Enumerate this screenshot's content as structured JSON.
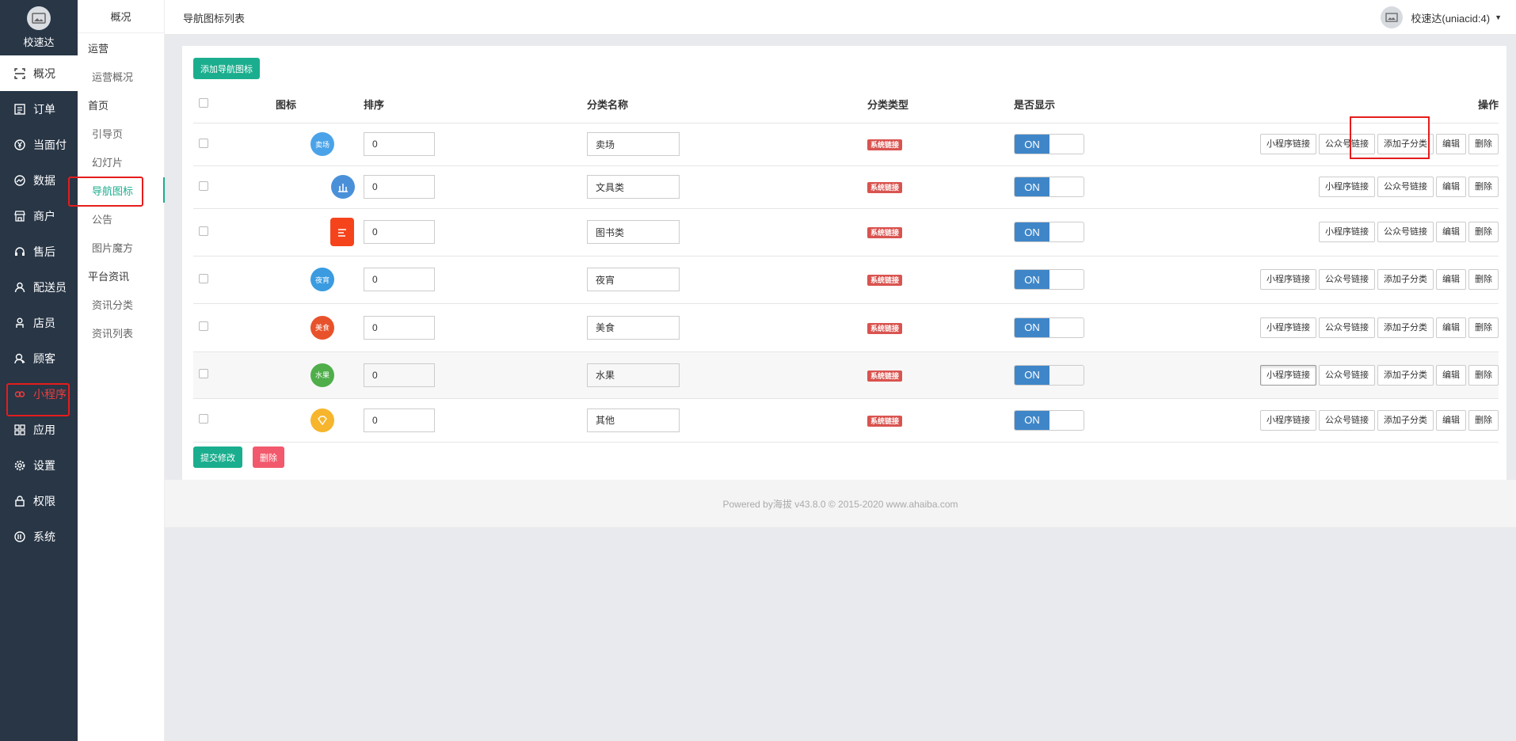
{
  "brand": {
    "name": "校速达"
  },
  "sidebar": {
    "items": [
      {
        "label": "概况",
        "icon": "overview-icon"
      },
      {
        "label": "订单",
        "icon": "order-icon"
      },
      {
        "label": "当面付",
        "icon": "yuan-icon"
      },
      {
        "label": "数据",
        "icon": "chart-icon"
      },
      {
        "label": "商户",
        "icon": "shop-icon"
      },
      {
        "label": "售后",
        "icon": "headset-icon"
      },
      {
        "label": "配送员",
        "icon": "user-icon"
      },
      {
        "label": "店员",
        "icon": "staff-icon"
      },
      {
        "label": "顾客",
        "icon": "customer-icon"
      },
      {
        "label": "小程序",
        "icon": "miniprogram-icon"
      },
      {
        "label": "应用",
        "icon": "apps-icon"
      },
      {
        "label": "设置",
        "icon": "gear-icon"
      },
      {
        "label": "权限",
        "icon": "lock-icon"
      },
      {
        "label": "系统",
        "icon": "system-icon"
      }
    ]
  },
  "subnav": {
    "title": "概况",
    "groups": [
      {
        "label": "运营",
        "items": [
          "运营概况"
        ]
      },
      {
        "label": "首页",
        "items": [
          "引导页",
          "幻灯片",
          "导航图标",
          "公告",
          "图片魔方"
        ]
      },
      {
        "label": "平台资讯",
        "items": [
          "资讯分类",
          "资讯列表"
        ]
      }
    ]
  },
  "header": {
    "title": "导航图标列表",
    "user": "校速达(uniacid:4)"
  },
  "toolbar": {
    "add_label": "添加导航图标"
  },
  "table": {
    "columns": [
      "图标",
      "排序",
      "分类名称",
      "分类类型",
      "是否显示",
      "操作"
    ],
    "type_badge": "系统链接",
    "toggle_on": "ON",
    "ops": {
      "mini": "小程序链接",
      "mp": "公众号链接",
      "sub": "添加子分类",
      "edit": "编辑",
      "del": "删除"
    },
    "rows": [
      {
        "sort": "0",
        "name": "卖场",
        "icon_text": "卖场",
        "icon_color": "#4aa3e8"
      },
      {
        "sort": "0",
        "name": "文具类",
        "icon_text": "",
        "icon_color": "#4a90d9"
      },
      {
        "sort": "0",
        "name": "图书类",
        "icon_text": "",
        "icon_color": "#f5441c"
      },
      {
        "sort": "0",
        "name": "夜宵",
        "icon_text": "夜宵",
        "icon_color": "#3a9be0"
      },
      {
        "sort": "0",
        "name": "美食",
        "icon_text": "美食",
        "icon_color": "#e8522b"
      },
      {
        "sort": "0",
        "name": "水果",
        "icon_text": "水果",
        "icon_color": "#4fae4a"
      },
      {
        "sort": "0",
        "name": "其他",
        "icon_text": "",
        "icon_color": "#f6b52c"
      }
    ]
  },
  "bottom": {
    "submit_label": "提交修改",
    "delete_label": "删除"
  },
  "footer": {
    "text": "Powered by海拔 v43.8.0 © 2015-2020 www.ahaiba.com"
  }
}
